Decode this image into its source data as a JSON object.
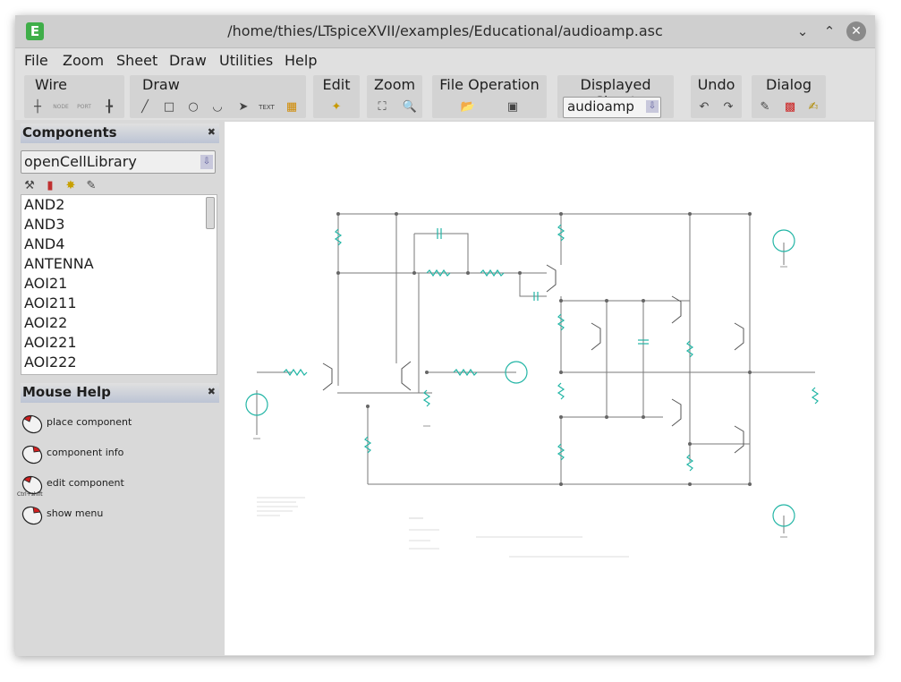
{
  "window": {
    "title": "/home/thies/LTspiceXVII/examples/Educational/audioamp.asc"
  },
  "menu": [
    "File",
    "Zoom",
    "Sheet",
    "Draw",
    "Utilities",
    "Help"
  ],
  "toolbar": {
    "groups": [
      "Wire",
      "Draw",
      "Edit",
      "Zoom",
      "File Operation",
      "Displayed Sheet",
      "Undo",
      "Dialog"
    ],
    "wire_icons": [
      "NODE",
      "PORT"
    ],
    "draw_text_icon": "TEXT",
    "displayed_sheet_value": "audioamp"
  },
  "components_panel": {
    "title": "Components",
    "library": "openCellLibrary",
    "items": [
      "AND2",
      "AND3",
      "AND4",
      "ANTENNA",
      "AOI21",
      "AOI211",
      "AOI22",
      "AOI221",
      "AOI222"
    ]
  },
  "mouse_help": {
    "title": "Mouse Help",
    "items": [
      "place component",
      "component info",
      "edit component",
      "show menu"
    ],
    "modifier_label": "Ctrl+shift"
  },
  "colors": {
    "wire": "#7a7a7a",
    "component": "#22b5a5",
    "node": "#666666"
  },
  "icons": [
    "app-icon",
    "minimize-icon",
    "maximize-icon",
    "close-icon",
    "wire-icon",
    "line-icon",
    "rect-icon",
    "circle-icon",
    "arc-icon",
    "arrow-icon",
    "text-icon",
    "symbol-icon",
    "edit-wand-icon",
    "zoom-fit-icon",
    "zoom-icon",
    "open-icon",
    "save-icon",
    "undo-icon",
    "redo-icon",
    "settings-icon",
    "color-icon",
    "notes-icon",
    "mouse-icon"
  ]
}
